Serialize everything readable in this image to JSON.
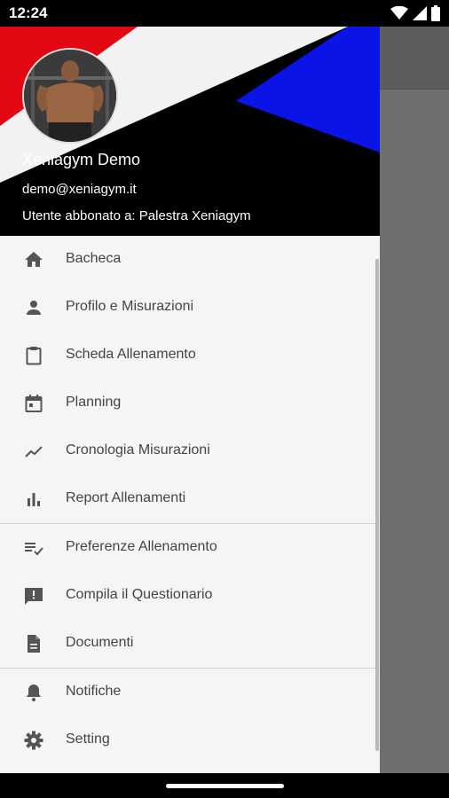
{
  "status_bar": {
    "time": "12:24",
    "icons": [
      "wifi-icon",
      "signal-icon",
      "battery-icon"
    ]
  },
  "drawer": {
    "header": {
      "name": "Xeniagym Demo",
      "email": "demo@xeniagym.it",
      "subscription": "Utente abbonato a: Palestra Xeniagym",
      "colors": {
        "red": "#e30613",
        "white": "#f2f2f2",
        "blue": "#0a14e6",
        "black": "#000000"
      }
    },
    "menu_groups": [
      [
        {
          "label": "Bacheca",
          "icon": "home-icon"
        },
        {
          "label": "Profilo e Misurazioni",
          "icon": "person-icon"
        },
        {
          "label": "Scheda Allenamento",
          "icon": "clipboard-icon"
        },
        {
          "label": "Planning",
          "icon": "calendar-icon"
        },
        {
          "label": "Cronologia Misurazioni",
          "icon": "trending-icon"
        },
        {
          "label": "Report Allenamenti",
          "icon": "bar-chart-icon"
        }
      ],
      [
        {
          "label": "Preferenze Allenamento",
          "icon": "checklist-icon"
        },
        {
          "label": "Compila il Questionario",
          "icon": "feedback-icon"
        },
        {
          "label": "Documenti",
          "icon": "document-icon"
        }
      ],
      [
        {
          "label": "Notifiche",
          "icon": "bell-icon"
        },
        {
          "label": "Setting",
          "icon": "gear-icon"
        }
      ]
    ]
  }
}
